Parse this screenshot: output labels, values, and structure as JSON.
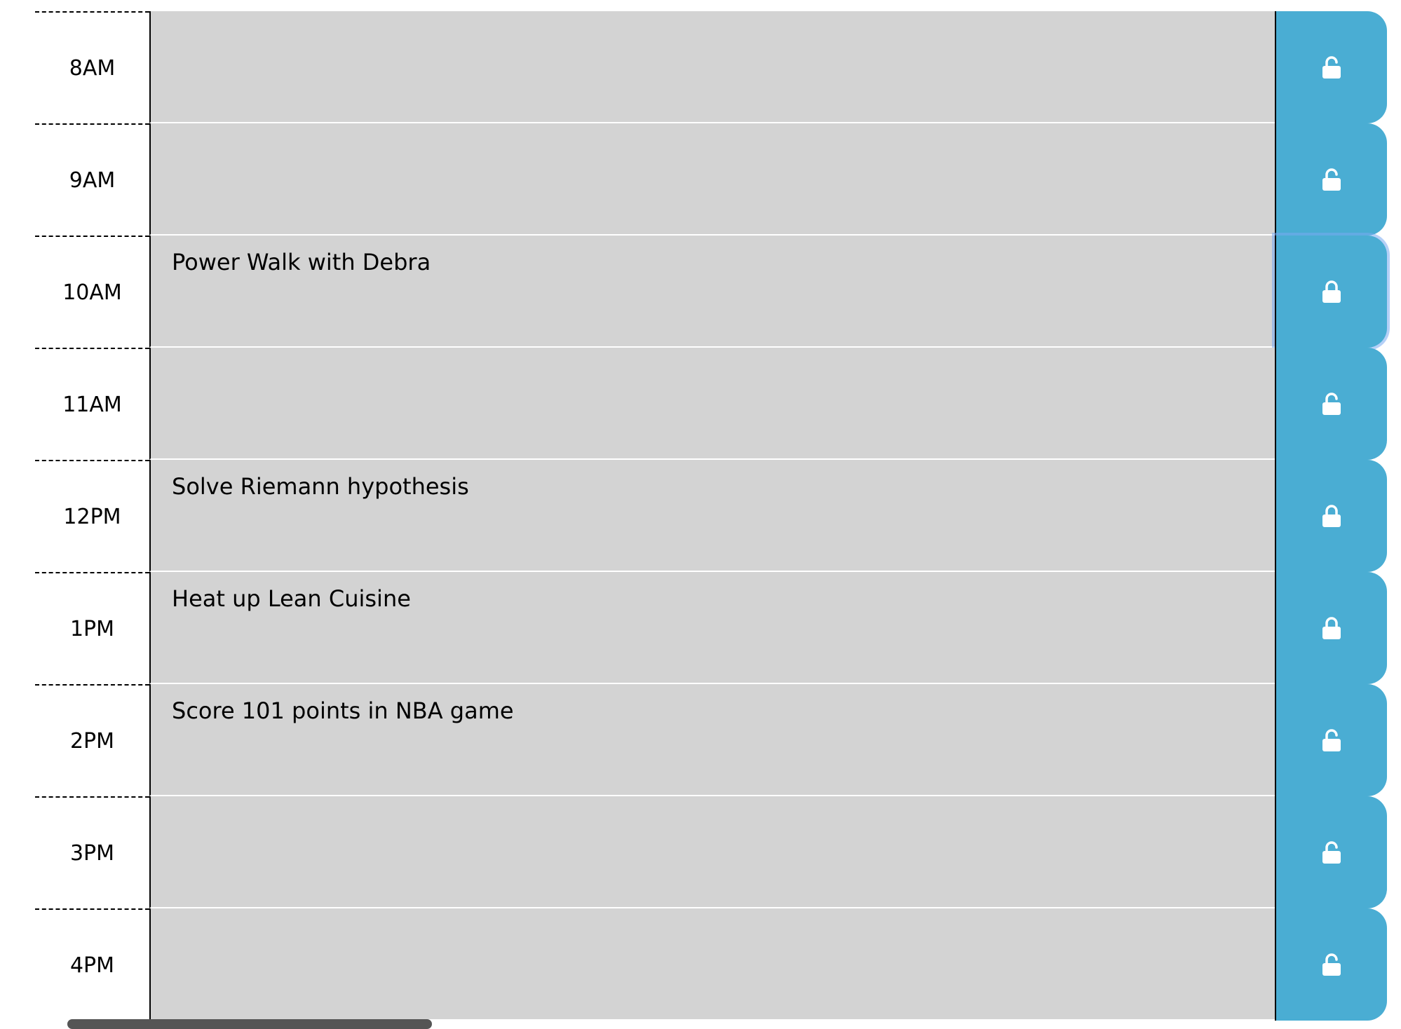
{
  "planner": {
    "blocks": [
      {
        "hour": "8AM",
        "text": "",
        "icon": "unlock-icon",
        "locked": false
      },
      {
        "hour": "9AM",
        "text": "",
        "icon": "unlock-icon",
        "locked": false
      },
      {
        "hour": "10AM",
        "text": "Power Walk with Debra",
        "icon": "lock-icon",
        "locked": true
      },
      {
        "hour": "11AM",
        "text": "",
        "icon": "unlock-icon",
        "locked": false
      },
      {
        "hour": "12PM",
        "text": "Solve Riemann hypothesis",
        "icon": "lock-icon",
        "locked": true
      },
      {
        "hour": "1PM",
        "text": "Heat up Lean Cuisine",
        "icon": "lock-icon",
        "locked": true
      },
      {
        "hour": "2PM",
        "text": "Score 101 points in NBA game",
        "icon": "unlock-icon",
        "locked": false
      },
      {
        "hour": "3PM",
        "text": "",
        "icon": "unlock-icon",
        "locked": false
      },
      {
        "hour": "4PM",
        "text": "",
        "icon": "unlock-icon",
        "locked": false
      }
    ]
  },
  "colors": {
    "description_bg": "#d3d3d3",
    "save_button_bg": "#4aadd3",
    "icon_color": "#ffffff"
  }
}
